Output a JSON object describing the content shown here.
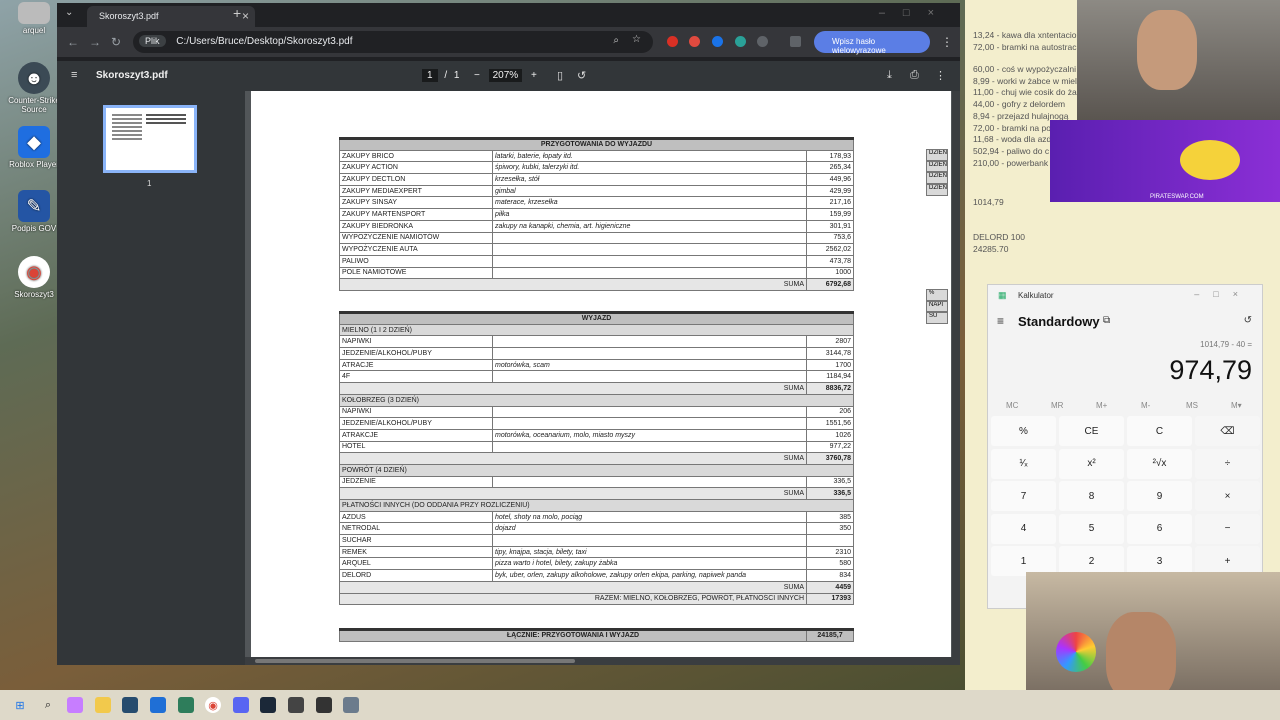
{
  "desktop": {
    "icons": [
      {
        "label": "arquel"
      },
      {
        "label": "Counter-Strike Source"
      },
      {
        "label": "Roblox Player"
      },
      {
        "label": "Podpis GOV"
      },
      {
        "label": "Skoroszyt3"
      }
    ]
  },
  "browser": {
    "tab_title": "Skoroszyt3.pdf",
    "omnibox_chip": "Plik",
    "url": "C:/Users/Bruce/Desktop/Skoroszyt3.pdf",
    "profile_label": "Wpisz hasło wielowyrazowe",
    "pdf": {
      "file_name": "Skoroszyt3.pdf",
      "page_current": "1",
      "page_total": "1",
      "zoom": "207%",
      "thumb_number": "1"
    }
  },
  "sheet": {
    "prep": {
      "title": "PRZYGOTOWANIA DO WYJAZDU",
      "rows": [
        {
          "name": "ZAKUPY BRICO",
          "desc": "latarki, baterie, łopaty itd.",
          "val": "178,93"
        },
        {
          "name": "ZAKUPY ACTION",
          "desc": "śpiwory, kubki, talerzyki itd.",
          "val": "265,34"
        },
        {
          "name": "ZAKUPY DECTLON",
          "desc": "krzesełka, stół",
          "val": "449,96"
        },
        {
          "name": "ZAKUPY MEDIAEXPERT",
          "desc": "gimbal",
          "val": "429,99"
        },
        {
          "name": "ZAKUPY SINSAY",
          "desc": "materace, krzesełka",
          "val": "217,16"
        },
        {
          "name": "ZAKUPY MARTENSPORT",
          "desc": "piłka",
          "val": "159,99"
        },
        {
          "name": "ZAKUPY BIEDRONKA",
          "desc": "zakupy na kanapki, chemia, art. higieniczne",
          "val": "301,91"
        },
        {
          "name": "WYPOŻYCZENIE NAMIOTÓW",
          "desc": "",
          "val": "753,6"
        },
        {
          "name": "WYPOŻYCZENIE AUTA",
          "desc": "",
          "val": "2562,02"
        },
        {
          "name": "PALIWO",
          "desc": "",
          "val": "473,78"
        },
        {
          "name": "POLE NAMIOTOWE",
          "desc": "",
          "val": "1000"
        }
      ],
      "sum_label": "SUMA",
      "sum": "6792,68"
    },
    "trip": {
      "title": "WYJAZD",
      "sections": [
        {
          "heading": "MIELNO (1 I 2 DZIEŃ)",
          "rows": [
            {
              "name": "NAPIWKI",
              "desc": "",
              "val": "2807"
            },
            {
              "name": "JEDZENIE/ALKOHOL/PUBY",
              "desc": "",
              "val": "3144,78"
            },
            {
              "name": "ATRACJE",
              "desc": "motorówka, scam",
              "val": "1700"
            },
            {
              "name": "4F",
              "desc": "",
              "val": "1184,94"
            }
          ],
          "sum_label": "SUMA",
          "sum": "8836,72"
        },
        {
          "heading": "KOŁOBRZEG (3 DZIEŃ)",
          "rows": [
            {
              "name": "NAPIWKI",
              "desc": "",
              "val": "206"
            },
            {
              "name": "JEDZENIE/ALKOHOL/PUBY",
              "desc": "",
              "val": "1551,56"
            },
            {
              "name": "ATRAKCJE",
              "desc": "motorówka, oceanarium, molo, miasto myszy",
              "val": "1026"
            },
            {
              "name": "HOTEL",
              "desc": "",
              "val": "977,22"
            }
          ],
          "sum_label": "SUMA",
          "sum": "3760,78"
        },
        {
          "heading": "POWRÓT (4 DZIEŃ)",
          "rows": [
            {
              "name": "JEDZENIE",
              "desc": "",
              "val": "336,5"
            }
          ],
          "sum_label": "SUMA",
          "sum": "336,5"
        },
        {
          "heading": "PŁATNOŚCI INNYCH (DO ODDANIA PRZY ROZLICZENIU)",
          "rows": [
            {
              "name": "AZDUS",
              "desc": "hotel, shoty na molo, pociąg",
              "val": "385"
            },
            {
              "name": "NETRODAL",
              "desc": "dojazd",
              "val": "350"
            },
            {
              "name": "SUCHAR",
              "desc": "",
              "val": ""
            },
            {
              "name": "REMEK",
              "desc": "tipy, knajpa, stacja, bilety, taxi",
              "val": "2310"
            },
            {
              "name": "ARQUEL",
              "desc": "pizza warto i hotel, bilety, zakupy żabka",
              "val": "580"
            },
            {
              "name": "DELORD",
              "desc": "byk, uber, orlen, zakupy alkoholowe, zakupy orlen ekipa, parking, napiwek panda",
              "val": "834"
            }
          ],
          "sum_label": "SUMA",
          "sum": "4459"
        }
      ],
      "total_label": "RAZEM: MIELNO, KOŁOBRZEG, POWRÓT, PŁATNOŚCI INNYCH",
      "total": "17393"
    },
    "grand": {
      "label": "ŁĄCZNIE: PRZYGOTOWANIA I WYJAZD",
      "value": "24185,7"
    },
    "right_fragments": [
      "DZIEŃ",
      "DZIEŃ",
      "DZIEŃ",
      "DZIEŃ",
      "%",
      "NAPI",
      "SU"
    ]
  },
  "notes": {
    "lines_top": [
      "13,24 - kawa dla xntentacio",
      "72,00 - bramki na autostrac",
      "60,00 - coś w wypożyczalni",
      "8,99 - worki w żabce w miel",
      "11,00 - chuj wie cosik do ża",
      "44,00 - gofry z delordem",
      "8,94 - przejazd hulajnogą",
      "72,00 - bramki na powro",
      "11,68 - woda dla azdusa",
      "502,94 - paliwo do c",
      "210,00 - powerbank"
    ],
    "total_line": "1014,79",
    "delord_line": "DELORD 100",
    "sum_line": "24285.70",
    "promo_text": "PIRATESWAP.COM"
  },
  "calculator": {
    "title": "Kalkulator",
    "mode": "Standardowy",
    "history": "1014,79 - 40 =",
    "display": "974,79",
    "memory": [
      "MC",
      "MR",
      "M+",
      "M-",
      "MS",
      "M▾"
    ],
    "keys": [
      [
        "%",
        "CE",
        "C",
        "⌫"
      ],
      [
        "¹⁄ₓ",
        "x²",
        "²√x",
        "÷"
      ],
      [
        "7",
        "8",
        "9",
        "×"
      ],
      [
        "4",
        "5",
        "6",
        "−"
      ],
      [
        "1",
        "2",
        "3",
        "+"
      ]
    ]
  }
}
